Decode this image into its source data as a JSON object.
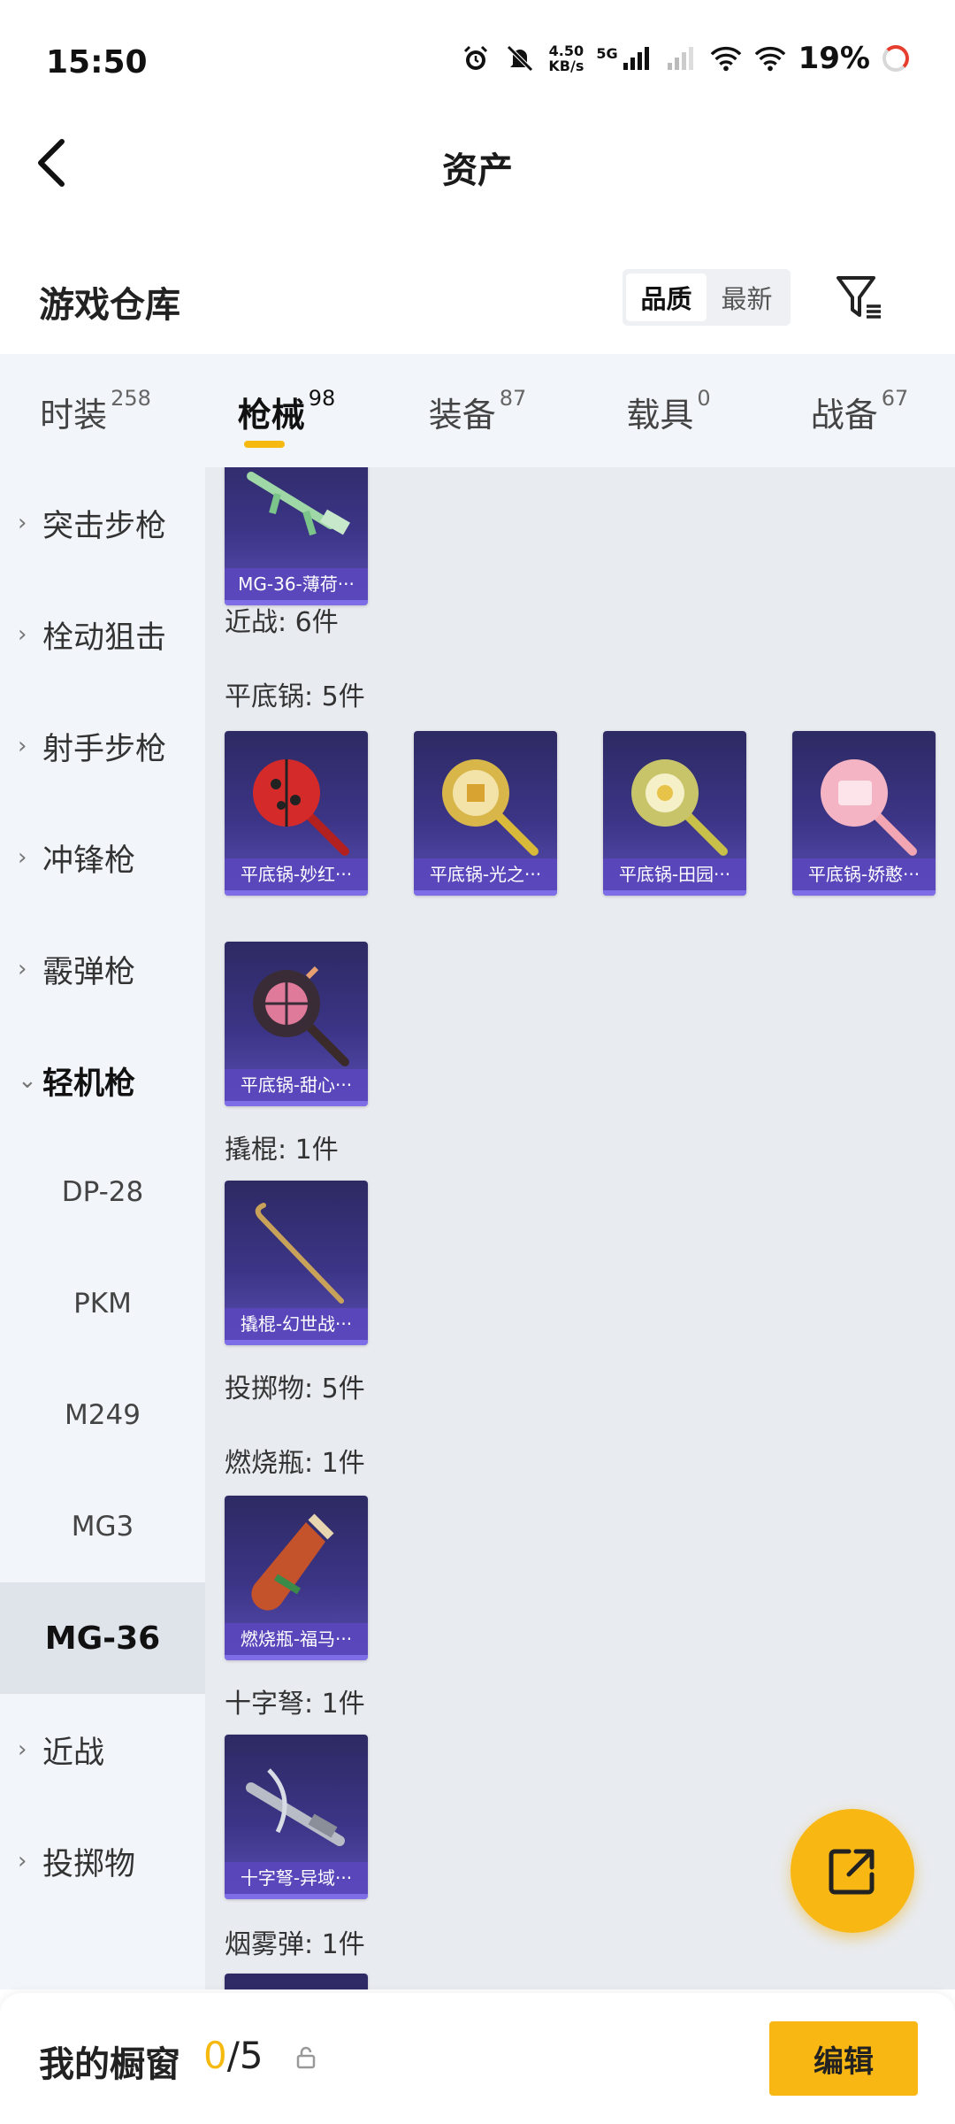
{
  "status_bar": {
    "time": "15:50",
    "net_speed_value": "4.50",
    "net_speed_unit": "KB/s",
    "network": "5G",
    "battery": "19%"
  },
  "header": {
    "title": "资产",
    "back_icon": "chevron-left-icon"
  },
  "warehouse": {
    "title": "游戏仓库",
    "sort_options": [
      "品质",
      "最新"
    ],
    "active_sort": "品质",
    "filter_icon": "filter-icon"
  },
  "tabs": [
    {
      "label": "时装",
      "count": "258"
    },
    {
      "label": "枪械",
      "count": "98"
    },
    {
      "label": "装备",
      "count": "87"
    },
    {
      "label": "载具",
      "count": "0"
    },
    {
      "label": "战备",
      "count": "67"
    }
  ],
  "active_tab": "枪械",
  "sidebar": {
    "categories": [
      "突击步枪",
      "栓动狙击",
      "射手步枪",
      "冲锋枪",
      "霰弹枪",
      "轻机枪"
    ],
    "expanded": "轻机枪",
    "subitems": [
      "DP-28",
      "PKM",
      "M249",
      "MG3",
      "MG-36"
    ],
    "selected_sub": "MG-36",
    "after": [
      "近战",
      "投掷物"
    ]
  },
  "content": {
    "groups": [
      {
        "label": "近战: 6件"
      },
      {
        "label": "平底锅: 5件"
      },
      {
        "label": "撬棍: 1件"
      },
      {
        "label": "投掷物: 5件"
      },
      {
        "label": "燃烧瓶: 1件"
      },
      {
        "label": "十字弩: 1件"
      },
      {
        "label": "烟雾弹: 1件"
      }
    ],
    "cards": [
      {
        "name": "MG-36-薄荷···"
      },
      {
        "name": "平底锅-妙红···"
      },
      {
        "name": "平底锅-光之···"
      },
      {
        "name": "平底锅-田园···"
      },
      {
        "name": "平底锅-娇憨···"
      },
      {
        "name": "平底锅-甜心···"
      },
      {
        "name": "撬棍-幻世战···"
      },
      {
        "name": "燃烧瓶-福马···"
      },
      {
        "name": "十字弩-异域···"
      }
    ]
  },
  "fab": {
    "icon": "share-external-icon"
  },
  "bottom_bar": {
    "title": "我的橱窗",
    "current": "0",
    "total": "/5",
    "lock_icon": "lock-icon",
    "edit_label": "编辑"
  },
  "colors": {
    "accent": "#f8b713",
    "card_bg": "#3c3587",
    "tab_bg": "#f2f5fa",
    "content_bg": "#e8ebf0"
  }
}
